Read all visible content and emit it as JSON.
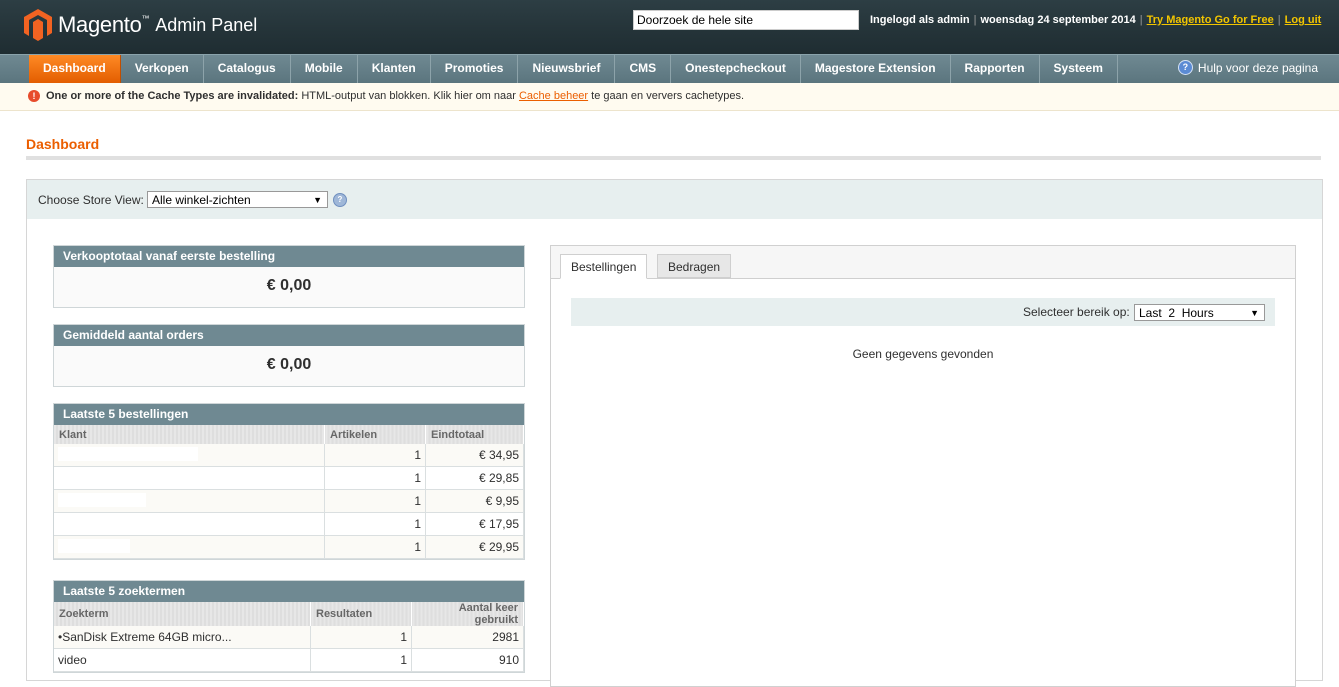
{
  "header": {
    "brand": "Magento",
    "brand_tm": "™",
    "brand_sub": "Admin Panel",
    "search_value": "Doorzoek de hele site",
    "logged_in": "Ingelogd als admin",
    "date": "woensdag 24 september 2014",
    "try_link": "Try Magento Go for Free",
    "logout_link": "Log uit"
  },
  "nav": {
    "items": [
      "Dashboard",
      "Verkopen",
      "Catalogus",
      "Mobile",
      "Klanten",
      "Promoties",
      "Nieuwsbrief",
      "CMS",
      "Onestepcheckout",
      "Magestore Extension",
      "Rapporten",
      "Systeem"
    ],
    "help": "Hulp voor deze pagina"
  },
  "notice": {
    "bold": "One or more of the Cache Types are invalidated:",
    "text": " HTML-output van blokken. Klik hier om naar ",
    "link": "Cache beheer",
    "tail": " te gaan en ververs cachetypes."
  },
  "page": {
    "title": "Dashboard"
  },
  "store": {
    "label": "Choose Store View:",
    "selected": "Alle winkel-zichten"
  },
  "cards": {
    "lifetime": {
      "title": "Verkooptotaal vanaf eerste bestelling",
      "value": "€ 0,00"
    },
    "average": {
      "title": "Gemiddeld aantal orders",
      "value": "€ 0,00"
    }
  },
  "last_orders": {
    "title": "Laatste 5 bestellingen",
    "headers": [
      "Klant",
      "Artikelen",
      "Eindtotaal"
    ],
    "rows": [
      {
        "items": "1",
        "total": "€ 34,95"
      },
      {
        "items": "1",
        "total": "€ 29,85"
      },
      {
        "items": "1",
        "total": "€ 9,95"
      },
      {
        "items": "1",
        "total": "€ 17,95"
      },
      {
        "items": "1",
        "total": "€ 29,95"
      }
    ]
  },
  "last_search": {
    "title": "Laatste 5 zoektermen",
    "headers": [
      "Zoekterm",
      "Resultaten",
      "Aantal keer gebruikt"
    ],
    "rows": [
      {
        "term": "•SanDisk Extreme 64GB micro...",
        "results": "1",
        "uses": "2981"
      },
      {
        "term": "video",
        "results": "1",
        "uses": "910"
      }
    ]
  },
  "chart_panel": {
    "tabs": [
      "Bestellingen",
      "Bedragen"
    ],
    "range_label": "Selecteer bereik op:",
    "range_selected": "Last  2  Hours",
    "no_data": "Geen gegevens gevonden"
  },
  "colors": {
    "accent": "#eb5e00",
    "header_bg": "#243338",
    "nav_bg": "#657f88"
  },
  "icons": {
    "logo": "magento-logo-icon",
    "help": "help-icon",
    "error": "error-icon",
    "question": "question-icon",
    "dropdown": "chevron-down-icon"
  }
}
